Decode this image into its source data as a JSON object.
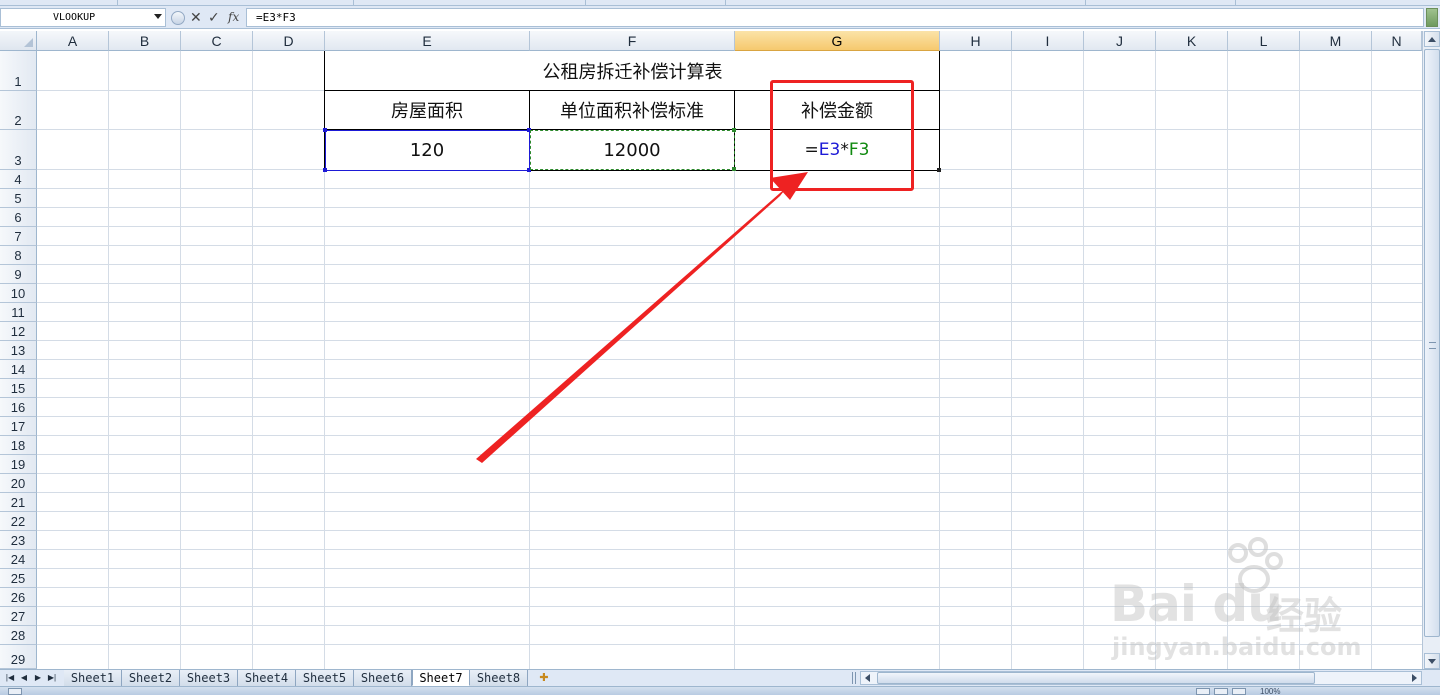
{
  "formula_bar": {
    "name_box": "VLOOKUP",
    "cancel_icon": "✕",
    "enter_icon": "✓",
    "fx_icon": "fx",
    "formula": "=E3*F3"
  },
  "columns": [
    "A",
    "B",
    "C",
    "D",
    "E",
    "F",
    "G",
    "H",
    "I",
    "J",
    "K",
    "L",
    "M",
    "N"
  ],
  "active_column": "G",
  "rows": [
    "1",
    "2",
    "3",
    "4",
    "5",
    "6",
    "7",
    "8",
    "9",
    "10",
    "11",
    "12",
    "13",
    "14",
    "15",
    "16",
    "17",
    "18",
    "19",
    "20",
    "21",
    "22",
    "23",
    "24",
    "25",
    "26",
    "27",
    "28",
    "29"
  ],
  "table": {
    "title": "公租房拆迁补偿计算表",
    "headers": [
      "房屋面积",
      "单位面积补偿标准",
      "补偿金额"
    ],
    "area": "120",
    "unit_standard": "12000",
    "formula_eq": "=",
    "formula_ref1": "E3",
    "formula_op": "*",
    "formula_ref2": "F3"
  },
  "sheet_tabs": [
    "Sheet1",
    "Sheet2",
    "Sheet3",
    "Sheet4",
    "Sheet5",
    "Sheet6",
    "Sheet7",
    "Sheet8"
  ],
  "active_sheet": "Sheet7",
  "status_bar": {
    "zoom": "100%"
  },
  "watermark": {
    "logo": "Bai du",
    "brand": "经验",
    "url": "jingyan.baidu.com"
  },
  "colors": {
    "annotation_red": "#ee2222",
    "ref_blue": "#1d1ad6",
    "ref_green": "#108a10",
    "header_active": "#f6c96e"
  }
}
